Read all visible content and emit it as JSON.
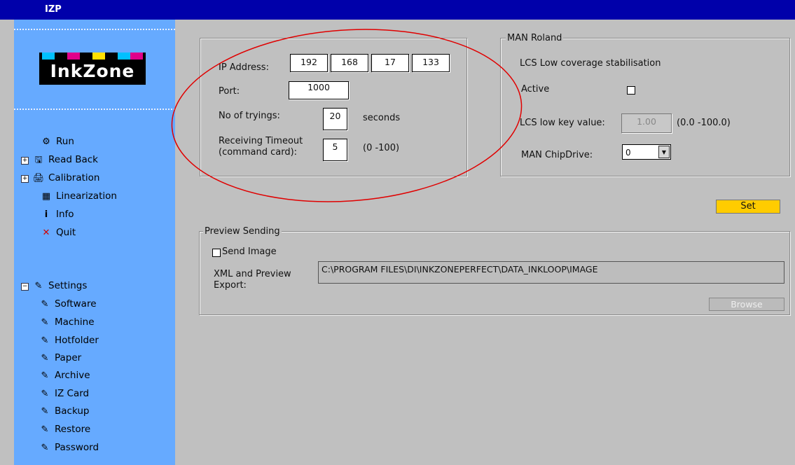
{
  "window": {
    "title": "IZP"
  },
  "logo": {
    "text": "InkZone"
  },
  "sidebar": {
    "items": [
      {
        "label": "Run",
        "icon": "run-icon"
      },
      {
        "label": "Read Back",
        "icon": "save-icon"
      },
      {
        "label": "Calibration",
        "icon": "calibration-icon"
      },
      {
        "label": "Linearization",
        "icon": "linearization-icon"
      },
      {
        "label": "Info",
        "icon": "info-icon"
      },
      {
        "label": "Quit",
        "icon": "close-icon"
      }
    ],
    "settings": {
      "label": "Settings",
      "children": [
        "Software",
        "Machine",
        "Hotfolder",
        "Paper",
        "Archive",
        "IZ Card",
        "Backup",
        "Restore",
        "Password"
      ]
    }
  },
  "connection": {
    "ip_label": "IP Address:",
    "ip": [
      "192",
      "168",
      "17",
      "133"
    ],
    "port_label": "Port:",
    "port": "1000",
    "tryings_label": "No of tryings:",
    "tryings": "20",
    "tryings_unit": "seconds",
    "timeout_label_1": "Receiving Timeout",
    "timeout_label_2": "(command card):",
    "timeout": "5",
    "timeout_range": "(0 -100)"
  },
  "man_roland": {
    "legend": "MAN Roland",
    "lcs_title": "LCS Low coverage stabilisation",
    "active_label": "Active",
    "active": false,
    "low_key_label": "LCS low key value:",
    "low_key_value": "1.00",
    "low_key_range": "(0.0 -100.0)",
    "chipdrive_label": "MAN ChipDrive:",
    "chipdrive_value": "0"
  },
  "set_button": "Set",
  "preview": {
    "legend": "Preview Sending",
    "send_image_label": "Send Image",
    "send_image": false,
    "export_label_1": "XML and Preview",
    "export_label_2": "Export:",
    "export_path": "C:\\PROGRAM FILES\\DI\\INKZONEPERFECT\\DATA_INKLOOP\\IMAGE",
    "browse_label": "Browse"
  },
  "colors": {
    "sidebar": "#66aaff",
    "titlebar": "#0000aa",
    "set_button": "#ffcc00",
    "annotation": "#e00000"
  }
}
